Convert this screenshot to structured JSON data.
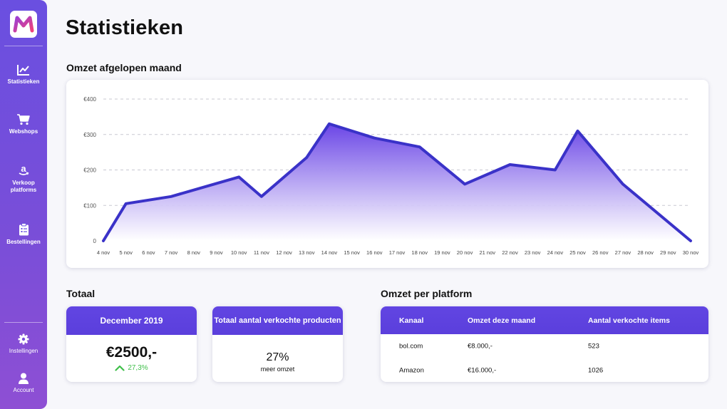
{
  "app": {
    "logo_letter": "M",
    "brand_color": "#6a4fe0"
  },
  "sidebar": {
    "items": [
      {
        "label": "Statistieken",
        "icon": "chart-line-icon"
      },
      {
        "label": "Webshops",
        "icon": "cart-icon"
      },
      {
        "label": "Verkoop\nplatforms",
        "icon": "amazon-icon"
      },
      {
        "label": "Bestellingen",
        "icon": "clipboard-icon"
      }
    ],
    "bottom_items": [
      {
        "label": "Instellingen",
        "icon": "gear-icon"
      },
      {
        "label": "Account",
        "icon": "user-icon"
      }
    ]
  },
  "page": {
    "title": "Statistieken"
  },
  "revenue_section": {
    "title": "Omzet afgelopen maand"
  },
  "chart_data": {
    "type": "area",
    "title": "",
    "xlabel": "",
    "ylabel": "",
    "x": [
      "4 nov",
      "5 nov",
      "6 nov",
      "7 nov",
      "8 nov",
      "9 nov",
      "10 nov",
      "11 nov",
      "12 nov",
      "13 nov",
      "14 nov",
      "15 nov",
      "16 nov",
      "17 nov",
      "18 nov",
      "19 nov",
      "20 nov",
      "21 nov",
      "22 nov",
      "23 nov",
      "24 nov",
      "25 nov",
      "26 nov",
      "27 nov",
      "28 nov",
      "29 nov",
      "30 nov"
    ],
    "points": [
      {
        "x": "4 nov",
        "y": 0
      },
      {
        "x": "5 nov",
        "y": 105
      },
      {
        "x": "7 nov",
        "y": 125
      },
      {
        "x": "10 nov",
        "y": 180
      },
      {
        "x": "11 nov",
        "y": 125
      },
      {
        "x": "13 nov",
        "y": 235
      },
      {
        "x": "14 nov",
        "y": 330
      },
      {
        "x": "16 nov",
        "y": 290
      },
      {
        "x": "18 nov",
        "y": 265
      },
      {
        "x": "20 nov",
        "y": 160
      },
      {
        "x": "22 nov",
        "y": 215
      },
      {
        "x": "24 nov",
        "y": 200
      },
      {
        "x": "25 nov",
        "y": 310
      },
      {
        "x": "27 nov",
        "y": 160
      },
      {
        "x": "30 nov",
        "y": 0
      }
    ],
    "y_ticks": [
      {
        "value": 0,
        "label": "0"
      },
      {
        "value": 100,
        "label": "€100"
      },
      {
        "value": 200,
        "label": "€200"
      },
      {
        "value": 300,
        "label": "€300"
      },
      {
        "value": 400,
        "label": "€400"
      }
    ],
    "ylim": [
      0,
      400
    ],
    "grid": true,
    "line_color": "#3a32c8",
    "fill_top": "#6a45e6",
    "fill_bottom": "#ffffff"
  },
  "totals": {
    "title": "Totaal",
    "month_card": {
      "header": "December 2019",
      "value": "€2500,-",
      "change": "27,3%",
      "change_color": "#3fbf4a"
    },
    "products_card": {
      "header": "Totaal aantal verkochte producten",
      "value": "27%",
      "subtitle": "meer omzet"
    }
  },
  "platform_section": {
    "title": "Omzet per platform",
    "columns": [
      "Kanaal",
      "Omzet deze maand",
      "Aantal verkochte items"
    ],
    "rows": [
      [
        "bol.com",
        "€8.000,-",
        "523"
      ],
      [
        "Amazon",
        "€16.000,-",
        "1026"
      ]
    ]
  }
}
